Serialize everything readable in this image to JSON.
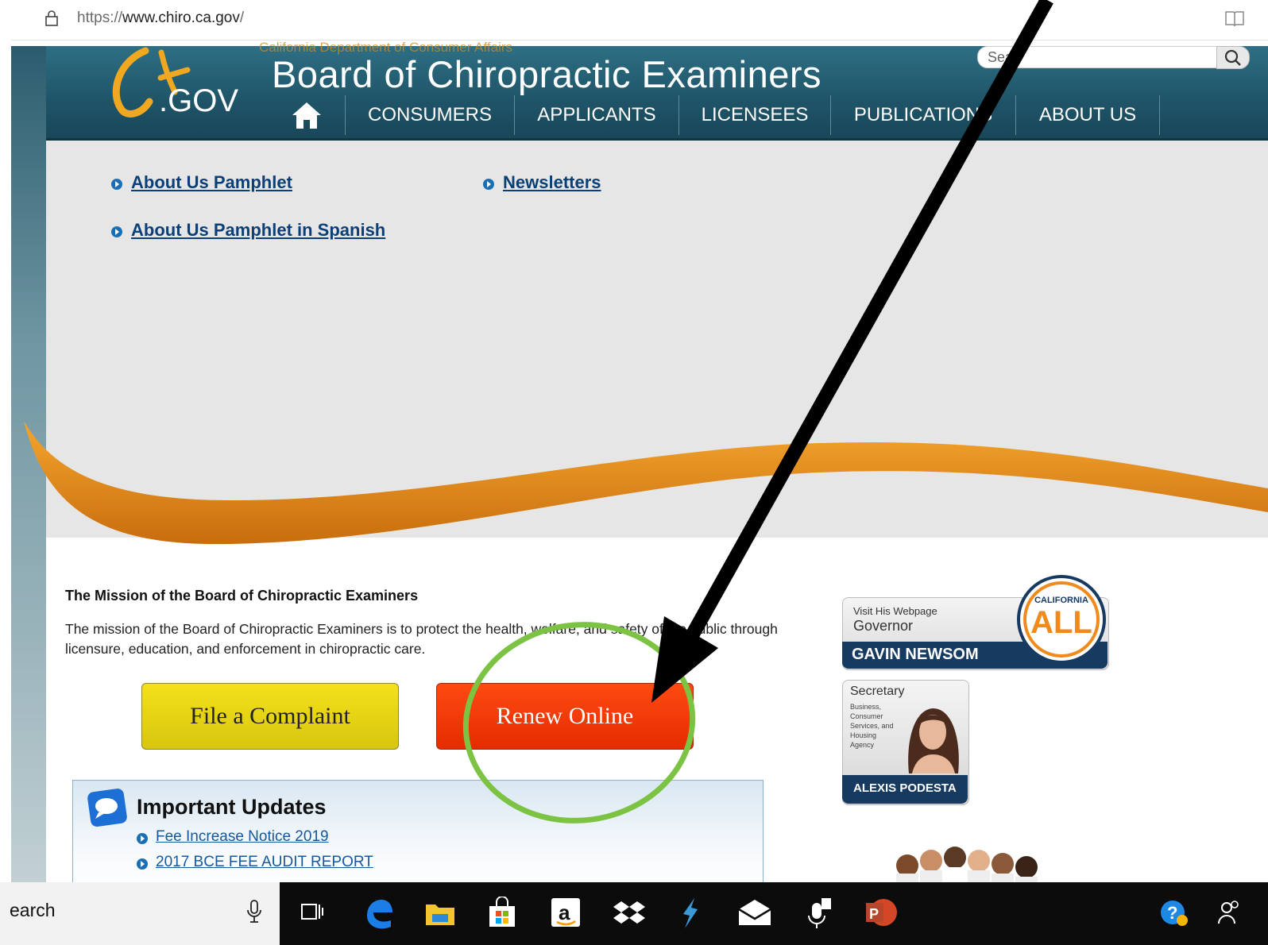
{
  "browser": {
    "url_prefix": "https://",
    "url_domain": "www.chiro.ca.gov",
    "url_suffix": "/"
  },
  "header": {
    "logo_text": ".GOV",
    "department": "California Department of Consumer Affairs",
    "title": "Board of Chiropractic Examiners",
    "search_placeholder": "Sear"
  },
  "nav": {
    "items": [
      "CONSUMERS",
      "APPLICANTS",
      "LICENSEES",
      "PUBLICATIONS",
      "ABOUT US"
    ]
  },
  "banner": {
    "links": [
      "About Us Pamphlet",
      "Newsletters",
      "About Us Pamphlet in Spanish"
    ]
  },
  "mission": {
    "title": "The Mission of the Board of Chiropractic Examiners",
    "text": "The mission of the Board of Chiropractic Examiners is to protect the health, welfare, and safety of the public through licensure, education, and enforcement in chiropractic care."
  },
  "buttons": {
    "complaint": "File a Complaint",
    "renew": "Renew Online"
  },
  "updates": {
    "title": "Important Updates",
    "links": [
      "Fee Increase Notice 2019",
      "2017 BCE FEE AUDIT REPORT"
    ]
  },
  "governor": {
    "visit": "Visit His Webpage",
    "role": "Governor",
    "name": "GAVIN NEWSOM",
    "badge_top": "CALIFORNIA",
    "badge_bottom": "ALL"
  },
  "secretary": {
    "role": "Secretary",
    "agency": "Business, Consumer Services, and Housing Agency",
    "name": "ALEXIS PODESTA"
  },
  "taskbar": {
    "search_text": "earch"
  },
  "colors": {
    "header": "#1f5468",
    "complaint_button": "#e8d414",
    "renew_button": "#f2360a",
    "annotation_circle": "#7cc243",
    "annotation_arrow": "#000000",
    "swoosh": "#e08a1e"
  }
}
